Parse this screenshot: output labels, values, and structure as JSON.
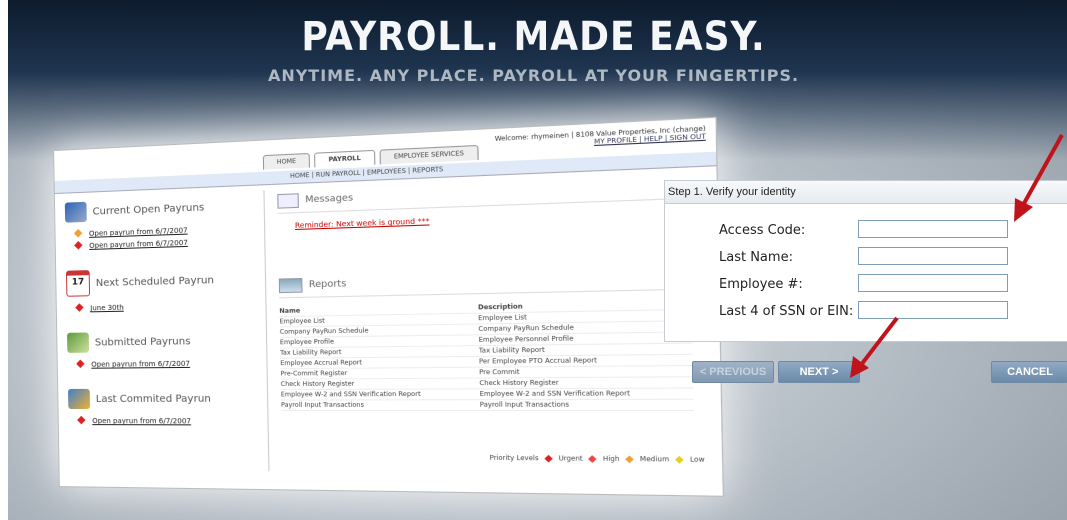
{
  "hero": {
    "headline": "PAYROLL. MADE EASY.",
    "tagline": "ANYTIME. ANY PLACE.  PAYROLL AT YOUR FINGERTIPS."
  },
  "mockup": {
    "welcome_line": "Welcome: rhymeinen | 8108 Value Properties, Inc (change)",
    "welcome_links": "MY PROFILE | HELP | SIGN OUT",
    "tabs": [
      "HOME",
      "PAYROLL",
      "EMPLOYEE SERVICES"
    ],
    "subnav": "HOME | RUN PAYROLL | EMPLOYEES | REPORTS",
    "sections": [
      {
        "title": "Current Open Payruns",
        "links": [
          "Open payrun from 6/7/2007",
          "Open payrun from 6/7/2007"
        ]
      },
      {
        "title": "Next Scheduled Payrun",
        "links": [
          "June 30th"
        ]
      },
      {
        "title": "Submitted Payruns",
        "links": [
          "Open payrun from 6/7/2007"
        ]
      },
      {
        "title": "Last Commited Payrun",
        "links": [
          "Open payrun from 6/7/2007"
        ]
      }
    ],
    "calendar_day": "17",
    "messages_title": "Messages",
    "reminder": "Reminder: Next week is ground ***",
    "reports_title": "Reports",
    "report_headers": [
      "Name",
      "Description"
    ],
    "reports": [
      [
        "Employee List",
        "Employee List"
      ],
      [
        "Company PayRun Schedule",
        "Company PayRun Schedule"
      ],
      [
        "Employee Profile",
        "Employee Personnel Profile"
      ],
      [
        "Tax Liability Report",
        "Tax Liability Report"
      ],
      [
        "Employee Accrual Report",
        "Per Employee PTO Accrual Report"
      ],
      [
        "Pre-Commit Register",
        "Pre Commit"
      ],
      [
        "Check History Register",
        "Check History Register"
      ],
      [
        "Employee W-2 and SSN Verification Report",
        "Employee W-2 and SSN Verification Report"
      ],
      [
        "Payroll Input Transactions",
        "Payroll Input Transactions"
      ]
    ],
    "priority_label": "Priority Levels",
    "priority_levels": [
      "Urgent",
      "High",
      "Medium",
      "Low"
    ]
  },
  "form": {
    "step_title": "Step 1. Verify your identity",
    "fields": [
      {
        "label": "Access Code:",
        "value": ""
      },
      {
        "label": "Last Name:",
        "value": ""
      },
      {
        "label": "Employee #:",
        "value": ""
      },
      {
        "label": "Last 4 of SSN or EIN:",
        "value": ""
      }
    ]
  },
  "buttons": {
    "previous": "< PREVIOUS",
    "next": "NEXT >",
    "cancel": "CANCEL"
  },
  "colors": {
    "annotation_arrow": "#c0141b",
    "button": "#6c89a8",
    "header_dark": "#0d1b2d"
  }
}
